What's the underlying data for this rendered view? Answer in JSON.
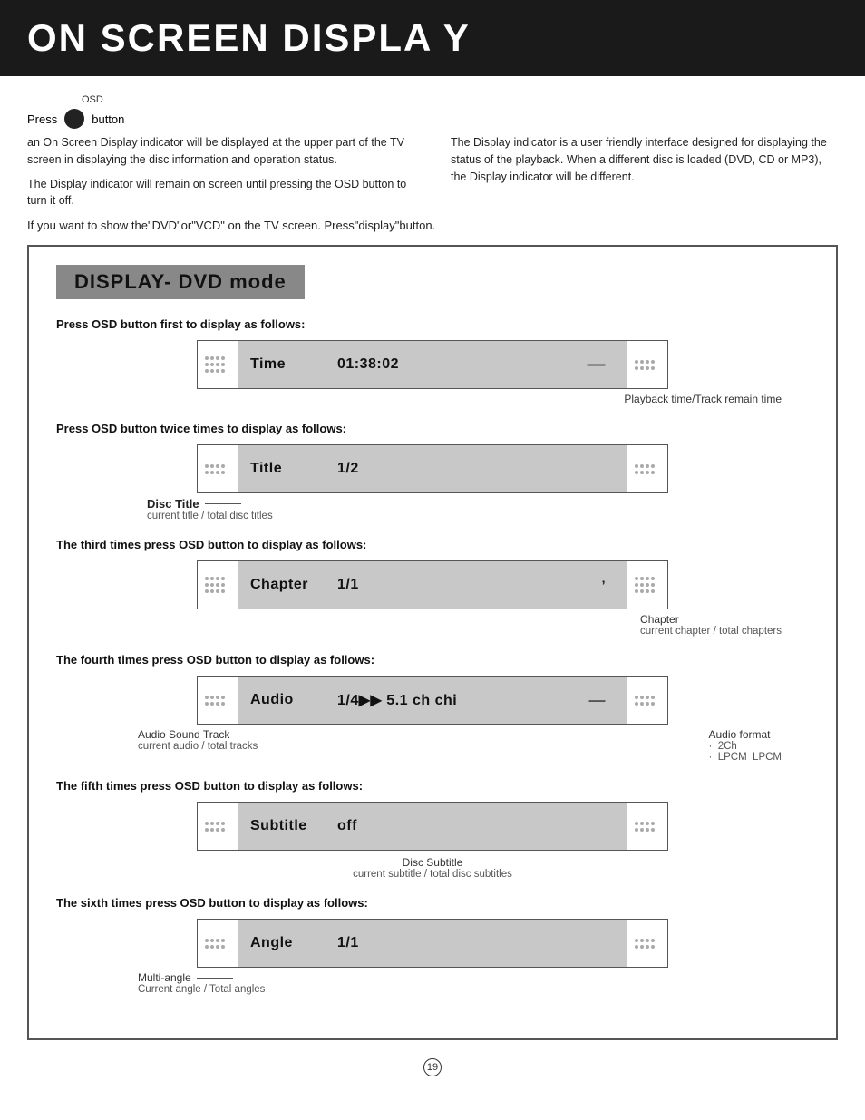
{
  "header": {
    "title": "ON SCREEN DISPLA Y"
  },
  "osd_label": "OSD",
  "press_text": "Press",
  "button_text": "button",
  "intro": {
    "left_para1": "an On Screen Display indicator will be displayed at the upper part of the TV screen in displaying the disc information and operation status.",
    "left_para2": "The Display indicator will remain on screen until pressing the OSD button to turn it off.",
    "right_para1": "The Display indicator  is a user friendly interface designed for displaying the status of  the playback. When a different disc is  loaded (DVD, CD or MP3), the Display indicator will be different."
  },
  "if_you_want": "If you want to show the\"DVD\"or\"VCD\"  on the  TV screen. Press\"display\"button.",
  "dvd_mode": {
    "header": "DISPLAY- DVD mode",
    "sections": [
      {
        "id": "time",
        "instruction": "Press OSD button first to display as follows:",
        "label": "Time",
        "value": "01:38:02",
        "annotation_right": "Playback time/Track remain time",
        "annotation_left": null
      },
      {
        "id": "title",
        "instruction": "Press OSD button twice times to display as follows:",
        "label": "Title",
        "value": "1/2",
        "annotation_left_main": "Disc Title",
        "annotation_left_sub": "current title / total disc titles",
        "annotation_right": null
      },
      {
        "id": "chapter",
        "instruction": "The third times press OSD button to display as follows:",
        "label": "Chapter",
        "value": "1/1",
        "annotation_right_main": "Chapter",
        "annotation_right_sub": "current chapter / total chapters"
      },
      {
        "id": "audio",
        "instruction": "The fourth times press OSD button to display as follows:",
        "label": "Audio",
        "value": "1/4▶▶  5.1  ch  chi",
        "annotation_left_main": "Audio Sound Track",
        "annotation_left_sub": "current audio / total tracks",
        "annotation_right_main": "Audio format",
        "audio_format_lines": "· 2Ch\n· LPCM LPCM"
      },
      {
        "id": "subtitle",
        "instruction": "The fifth times press OSD button to display as follows:",
        "label": "Subtitle",
        "value": "off",
        "annotation_center_main": "Disc Subtitle",
        "annotation_center_sub": "current subtitle / total disc subtitles"
      },
      {
        "id": "angle",
        "instruction": "The sixth times press OSD button to display as follows:",
        "label": "Angle",
        "value": "1/1",
        "annotation_left_main": "Multi-angle",
        "annotation_left_sub": "Current angle / Total angles"
      }
    ]
  },
  "page_number": "19"
}
